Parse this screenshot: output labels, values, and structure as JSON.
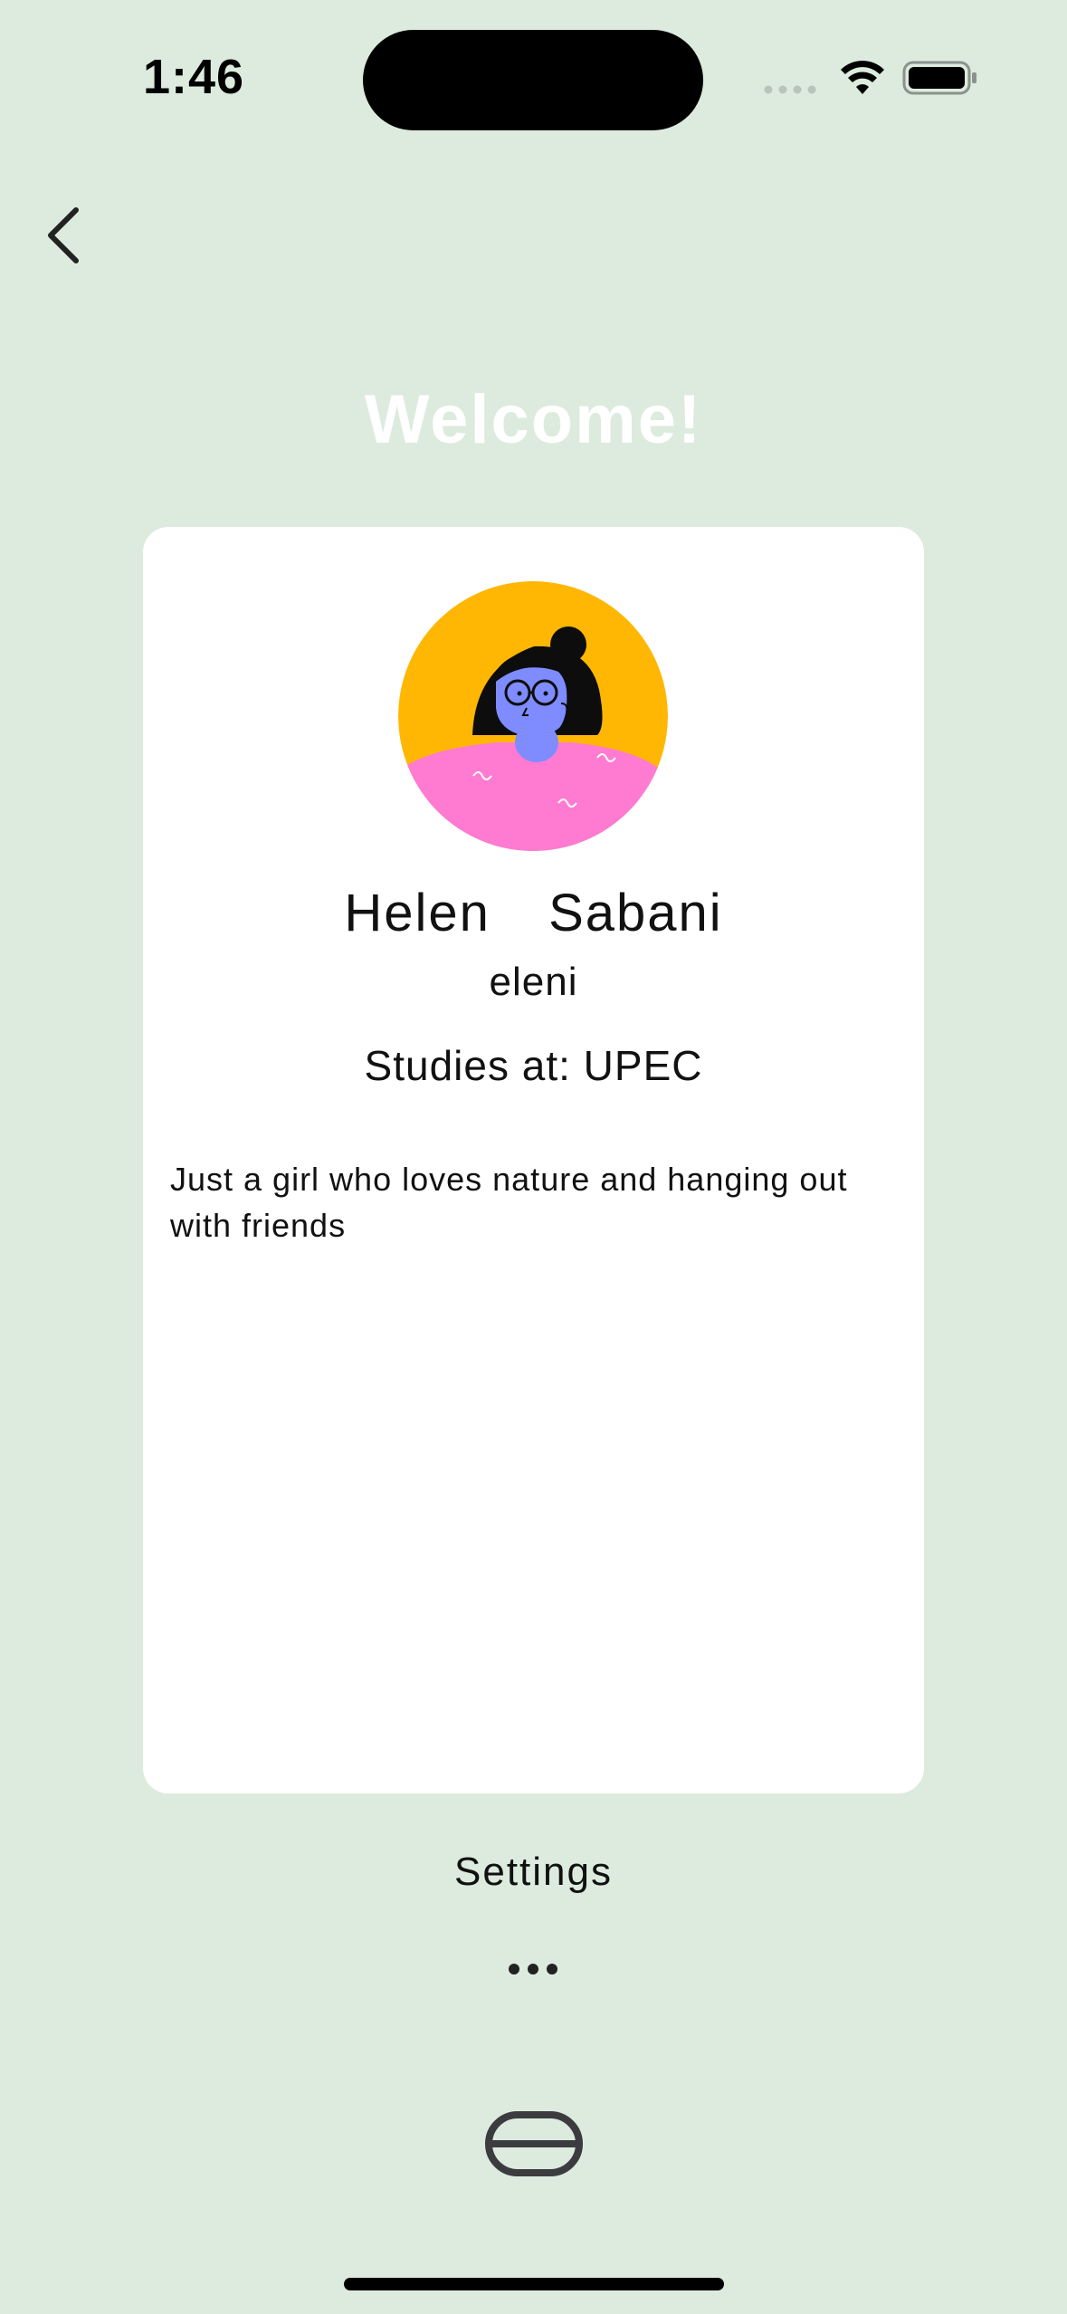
{
  "status_bar": {
    "time": "1:46",
    "icons": [
      "cellular-signal-icon",
      "wifi-icon",
      "battery-icon"
    ]
  },
  "nav": {
    "back_icon": "chevron-left-icon"
  },
  "header": {
    "title": "Welcome!"
  },
  "profile": {
    "full_name": "Helen  Sabani",
    "username": "eleni",
    "school": "Studies at: UPEC",
    "bio": "Just a girl who loves nature and hanging out with friends",
    "avatar_icon": "avatar-illustration"
  },
  "footer": {
    "settings_label": "Settings",
    "more_icon": "more-dots-icon",
    "bottom_icon": "pill-icon"
  },
  "colors": {
    "background": "#dcebdd",
    "card": "#ffffff",
    "avatar_bg": "#ffb703",
    "avatar_shirt": "#ff7ad1",
    "avatar_skin": "#7f8cff"
  }
}
